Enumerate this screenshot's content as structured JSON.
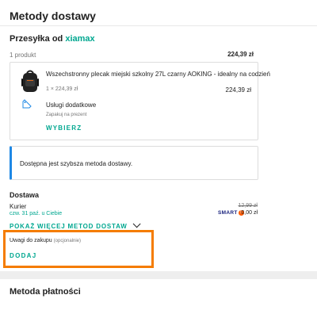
{
  "header": {
    "title": "Metody dostawy"
  },
  "seller": {
    "prefix": "Przesyłka od",
    "name": "xiamax",
    "count": "1 produkt",
    "total": "224,39 zł"
  },
  "product": {
    "title": "Wszechstronny plecak miejski szkolny 27L czarny AOKING - idealny na codzień",
    "qty": "1 × 224,39 zł",
    "price": "224,39 zł",
    "icon": "backpack-image"
  },
  "services": {
    "title": "Usługi dodatkowe",
    "subtitle": "Zapakuj na prezent",
    "choose_label": "WYBIERZ",
    "icon": "gift-tag-icon"
  },
  "info": {
    "text": "Dostępna jest szybsza metoda dostawy.",
    "accent": "#1e88e5"
  },
  "delivery": {
    "title": "Dostawa",
    "method": "Kurier",
    "eta": "czw. 31 paź. u Ciebie",
    "old_price": "12,99 zł",
    "smart_label": "SMART",
    "smart_badge": "!",
    "new_price": "0,00 zł",
    "more_label": "POKAŻ WIĘCEJ METOD DOSTAW"
  },
  "remarks": {
    "label": "Uwagi do zakupu",
    "optional": "(opcjonalnie)",
    "add_label": "DODAJ",
    "highlight": "#f57c00"
  },
  "payment": {
    "title": "Metoda płatności"
  },
  "colors": {
    "accent": "#00a790",
    "text": "#222222",
    "muted": "#767676"
  }
}
